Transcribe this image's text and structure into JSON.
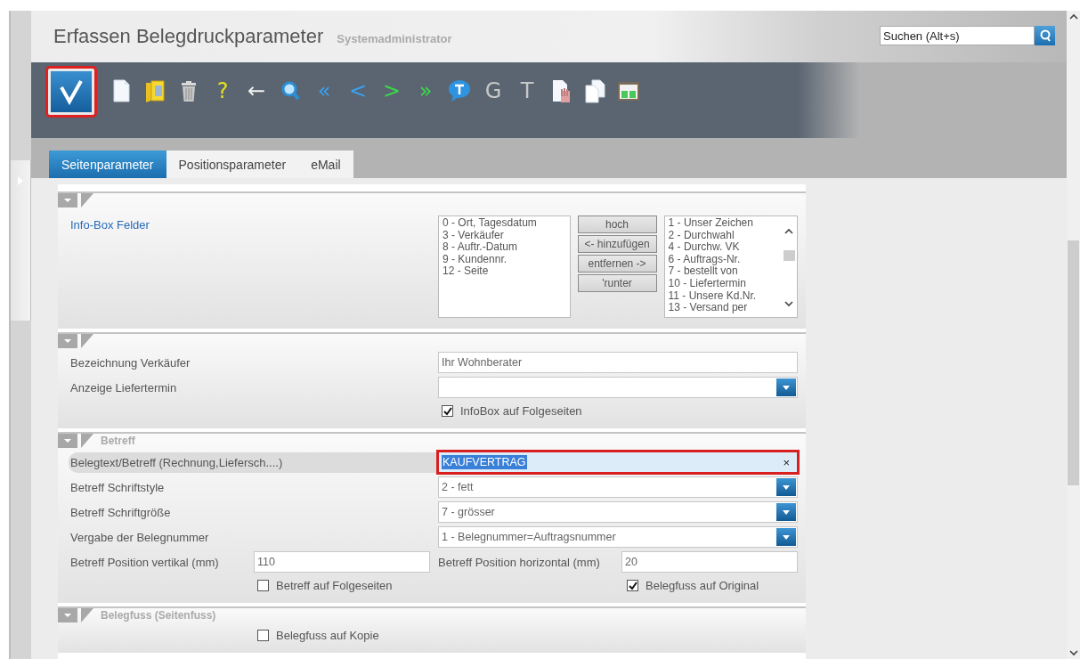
{
  "header": {
    "title": "Erfassen Belegdruckparameter",
    "user": "Systemadministrator",
    "search": {
      "placeholder": "Suchen (Alt+s)"
    }
  },
  "toolbar": [
    {
      "kind": "check",
      "highlighted": true
    },
    {
      "kind": "page"
    },
    {
      "kind": "folder"
    },
    {
      "kind": "trash"
    },
    {
      "kind": "glyph",
      "text": "?",
      "color": "#e6e020"
    },
    {
      "kind": "glyph",
      "text": "←",
      "color": "#f0f0f0"
    },
    {
      "kind": "magnifier"
    },
    {
      "kind": "glyph",
      "text": "«",
      "color": "#3aa0ef"
    },
    {
      "kind": "glyph",
      "text": "<",
      "color": "#3aa0ef"
    },
    {
      "kind": "glyph",
      "text": ">",
      "color": "#3cd84a"
    },
    {
      "kind": "glyph",
      "text": "»",
      "color": "#3cd84a"
    },
    {
      "kind": "bubble"
    },
    {
      "kind": "glyph",
      "text": "G",
      "color": "#c8c8c8"
    },
    {
      "kind": "glyph",
      "text": "T",
      "color": "#c8c8c8"
    },
    {
      "kind": "hand-page"
    },
    {
      "kind": "pages"
    },
    {
      "kind": "board"
    }
  ],
  "tabs": [
    {
      "label": "Seitenparameter",
      "selected": true
    },
    {
      "label": "Positionsparameter",
      "selected": false
    },
    {
      "label": "eMail",
      "selected": false
    }
  ],
  "sections": [
    {
      "rows": [
        {
          "kind": "transfer",
          "label": "Info-Box Felder",
          "left": [
            "0 - Ort, Tagesdatum",
            "3 - Verkäufer",
            "8 - Auftr.-Datum",
            "9 - Kundennr.",
            "12 - Seite"
          ],
          "buttons": [
            "hoch",
            "<- hinzufügen",
            "entfernen ->",
            "'runter"
          ],
          "right": [
            "1 - Unser Zeichen",
            "2 - Durchwahl",
            "4 - Durchw. VK",
            "6 - Auftrags-Nr.",
            "7 - bestellt von",
            "10 - Liefertermin",
            "11 - Unsere Kd.Nr.",
            "13 - Versand per"
          ]
        }
      ]
    },
    {
      "rows": [
        {
          "kind": "text",
          "label": "Bezeichnung Verkäufer",
          "value": "Ihr Wohnberater"
        },
        {
          "kind": "select",
          "label": "Anzeige Liefertermin"
        },
        {
          "kind": "check-right",
          "items": [
            {
              "label": "InfoBox auf Folgeseiten",
              "checked": true
            }
          ]
        }
      ]
    },
    {
      "title": "Betreff",
      "rows": [
        {
          "kind": "text",
          "label": "Belegtext/Betreff (Rechnung,Liefersch....)",
          "value": "KAUFVERTRAG",
          "highlighted": true,
          "hovered": true,
          "value_selected": true,
          "clear": "×"
        },
        {
          "kind": "select",
          "label": "Betreff Schriftstyle",
          "value": "2 - fett"
        },
        {
          "kind": "select",
          "label": "Betreff Schriftgröße",
          "value": "7 - grösser"
        },
        {
          "kind": "select",
          "label": "Vergabe der Belegnummer",
          "value": "1 - Belegnummer=Auftragsnummer"
        },
        {
          "kind": "pair",
          "fields": [
            {
              "label": "Betreff Position vertikal (mm)",
              "value": "110"
            },
            {
              "label": "Betreff Position horizontal (mm)",
              "value": "20"
            }
          ]
        },
        {
          "kind": "check-pair",
          "items": [
            {
              "label": "Betreff auf Folgeseiten",
              "checked": false
            },
            {
              "label": "Belegfuss auf Original",
              "checked": true
            }
          ]
        }
      ]
    },
    {
      "title": "Belegfuss (Seitenfuss)",
      "rows": [
        {
          "kind": "check-left",
          "items": [
            {
              "label": "Belegfuss auf Kopie",
              "checked": false
            }
          ]
        }
      ]
    }
  ]
}
